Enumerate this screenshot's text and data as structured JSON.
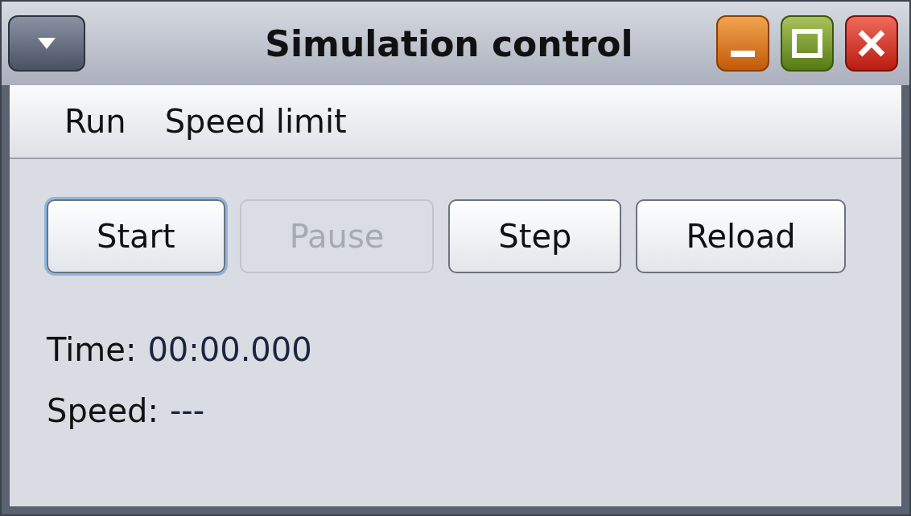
{
  "window": {
    "title": "Simulation control"
  },
  "menu": [
    {
      "label": "Run"
    },
    {
      "label": "Speed limit"
    }
  ],
  "buttons": [
    {
      "label": "Start",
      "disabled": false,
      "focused": true
    },
    {
      "label": "Pause",
      "disabled": true,
      "focused": false
    },
    {
      "label": "Step",
      "disabled": false,
      "focused": false
    },
    {
      "label": "Reload",
      "disabled": false,
      "focused": false
    }
  ],
  "readouts": [
    {
      "label": "Time:",
      "value": "00:00.000"
    },
    {
      "label": "Speed:",
      "value": "---"
    }
  ]
}
